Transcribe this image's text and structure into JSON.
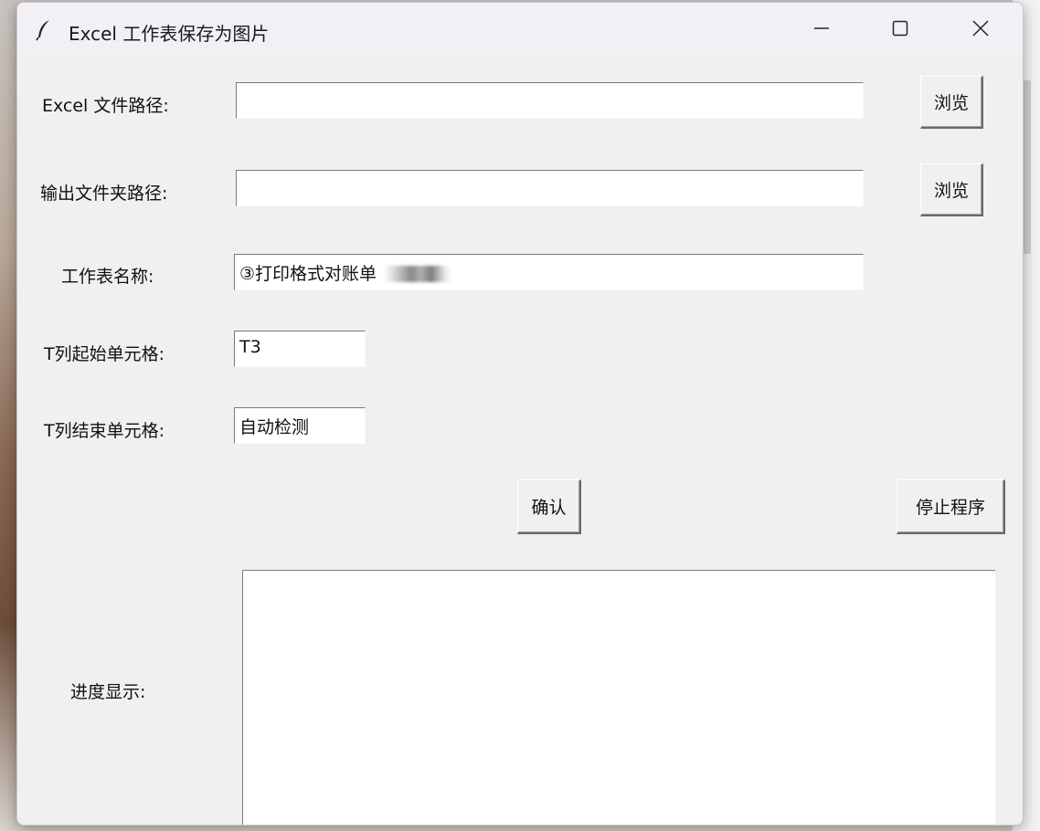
{
  "window": {
    "title": "Excel 工作表保存为图片",
    "icon": "feather-icon"
  },
  "controls": {
    "minimize": "minimize-icon",
    "maximize": "maximize-icon",
    "close": "close-icon"
  },
  "form": {
    "excel_path_label": "Excel 文件路径:",
    "excel_path_value": "",
    "excel_browse_label": "浏览",
    "output_folder_label": "输出文件夹路径:",
    "output_folder_value": "",
    "output_browse_label": "浏览",
    "sheet_name_label": "工作表名称:",
    "sheet_name_value": "③打印格式对账单",
    "start_cell_label": "T列起始单元格:",
    "start_cell_value": "T3",
    "end_cell_label": "T列结束单元格:",
    "end_cell_value": "自动检测",
    "confirm_label": "确认",
    "stop_label": "停止程序",
    "progress_label": "进度显示:",
    "progress_text": ""
  }
}
